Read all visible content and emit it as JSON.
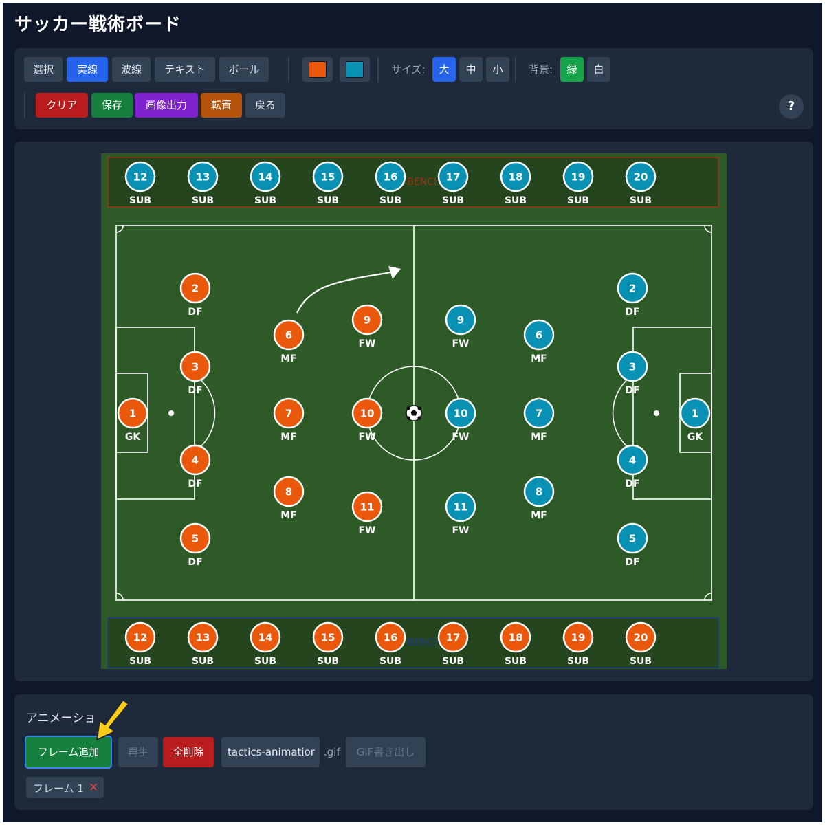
{
  "app": {
    "title": "サッカー戦術ボード"
  },
  "toolbar": {
    "tools": [
      "選択",
      "実線",
      "波線",
      "テキスト",
      "ボール"
    ],
    "active_tool": "実線",
    "team_colors": [
      "#ea580c",
      "#0891b2"
    ],
    "size_label": "サイズ:",
    "sizes": [
      "大",
      "中",
      "小"
    ],
    "active_size": "大",
    "bg_label": "背景:",
    "backgrounds": [
      "緑",
      "白"
    ],
    "active_bg": "緑",
    "clear": "クリア",
    "save": "保存",
    "export_image": "画像出力",
    "flip": "転置",
    "undo": "戻る",
    "help": "?"
  },
  "board": {
    "bench_label": "BENCH",
    "sub_label": "SUB",
    "bench_numbers": [
      "12",
      "13",
      "14",
      "15",
      "16",
      "17",
      "18",
      "19",
      "20"
    ],
    "home_color": "#ea580c",
    "away_color": "#0891b2",
    "pitch_color": "#2d5a27",
    "home_players": [
      {
        "num": "1",
        "pos": "GK"
      },
      {
        "num": "2",
        "pos": "DF"
      },
      {
        "num": "3",
        "pos": "DF"
      },
      {
        "num": "4",
        "pos": "DF"
      },
      {
        "num": "5",
        "pos": "DF"
      },
      {
        "num": "6",
        "pos": "MF"
      },
      {
        "num": "7",
        "pos": "MF"
      },
      {
        "num": "8",
        "pos": "MF"
      },
      {
        "num": "9",
        "pos": "FW"
      },
      {
        "num": "10",
        "pos": "FW"
      },
      {
        "num": "11",
        "pos": "FW"
      }
    ],
    "away_players": [
      {
        "num": "1",
        "pos": "GK"
      },
      {
        "num": "2",
        "pos": "DF"
      },
      {
        "num": "3",
        "pos": "DF"
      },
      {
        "num": "4",
        "pos": "DF"
      },
      {
        "num": "5",
        "pos": "DF"
      },
      {
        "num": "6",
        "pos": "MF"
      },
      {
        "num": "7",
        "pos": "MF"
      },
      {
        "num": "8",
        "pos": "MF"
      },
      {
        "num": "9",
        "pos": "FW"
      },
      {
        "num": "10",
        "pos": "FW"
      },
      {
        "num": "11",
        "pos": "FW"
      }
    ]
  },
  "animation": {
    "title": "アニメーショ",
    "add_frame": "フレーム追加",
    "play": "再生",
    "delete_all": "全削除",
    "filename_value": "tactics-animatior",
    "file_ext": ".gif",
    "export_gif": "GIF書き出し",
    "frames": [
      "フレーム 1"
    ],
    "remove_icon": "×"
  }
}
